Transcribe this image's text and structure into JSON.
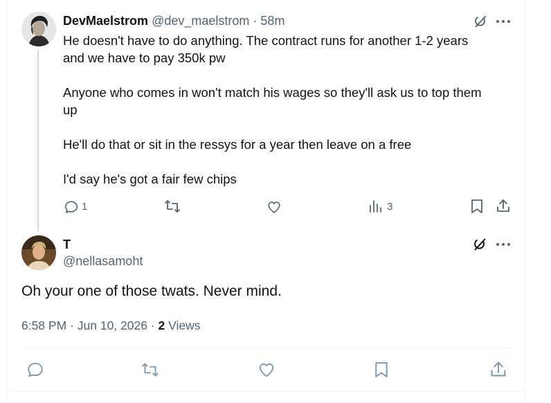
{
  "reply_tweet": {
    "display_name": "DevMaelstrom",
    "handle": "@dev_maelstrom",
    "separator": "·",
    "time": "58m",
    "text_lines": [
      "He doesn't have to do anything.  The contract runs for another 1-2 years",
      "and we have to pay 350k pw",
      "Anyone who comes in won't match his wages so they'll ask us to top them",
      "up",
      "He'll do that or sit in the ressys for a year then leave on a free",
      "I'd say he's got a fair few chips"
    ],
    "reply_count": "1",
    "views_count": "3"
  },
  "main_tweet": {
    "display_name": "T",
    "handle": "@nellasamoht",
    "text": "Oh your one of those twats. Never mind.",
    "time": "6:58 PM",
    "date": "Jun 10, 2026",
    "dot1": "·",
    "dot2": "·",
    "views_count": "2",
    "views_label": "Views"
  },
  "colors": {
    "text_primary": "#0f1419",
    "text_muted": "#536471",
    "action_icon": "#536471",
    "bottom_icon": "#829aab",
    "border": "#eff3f4",
    "thread_line": "#cfd9de"
  },
  "icons": {
    "grok": "grok-icon",
    "more": "more-icon",
    "reply": "reply-icon",
    "retweet": "retweet-icon",
    "like": "like-icon",
    "views": "views-icon",
    "bookmark": "bookmark-icon",
    "share": "share-icon"
  }
}
